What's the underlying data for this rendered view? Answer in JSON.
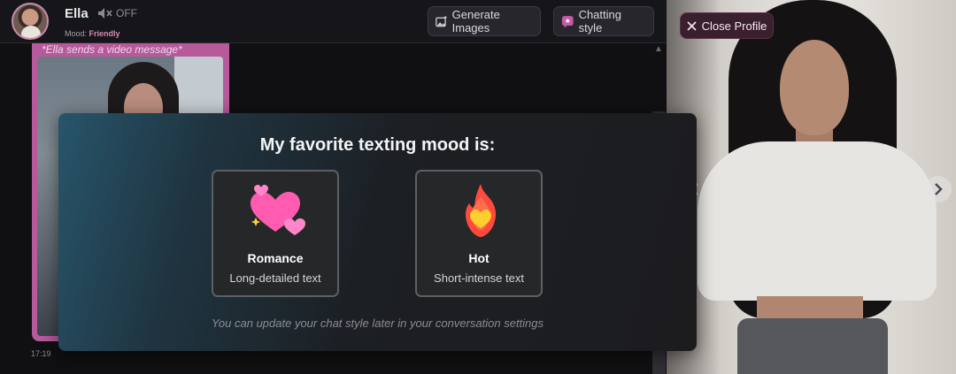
{
  "header": {
    "name": "Ella",
    "mute_label": "OFF",
    "mood_label": "Mood:",
    "mood_value": "Friendly",
    "generate_images": "Generate Images",
    "chatting_style": "Chatting style"
  },
  "chat": {
    "video_caption": "*Ella sends a video message*",
    "time": "17:19"
  },
  "profile": {
    "close_label": "Close Profile"
  },
  "modal": {
    "title": "My favorite texting mood is:",
    "options": [
      {
        "name": "Romance",
        "description": "Long-detailed text",
        "icon": "hearts-icon"
      },
      {
        "name": "Hot",
        "description": "Short-intense text",
        "icon": "flame-heart-icon"
      }
    ],
    "note": "You can update your chat style later in your conversation settings"
  },
  "colors": {
    "accent_pink": "#b65a9c",
    "mood_pink": "#d88ab0",
    "modal_bg": "#1c1c1f",
    "modal_teal": "#27556b"
  }
}
